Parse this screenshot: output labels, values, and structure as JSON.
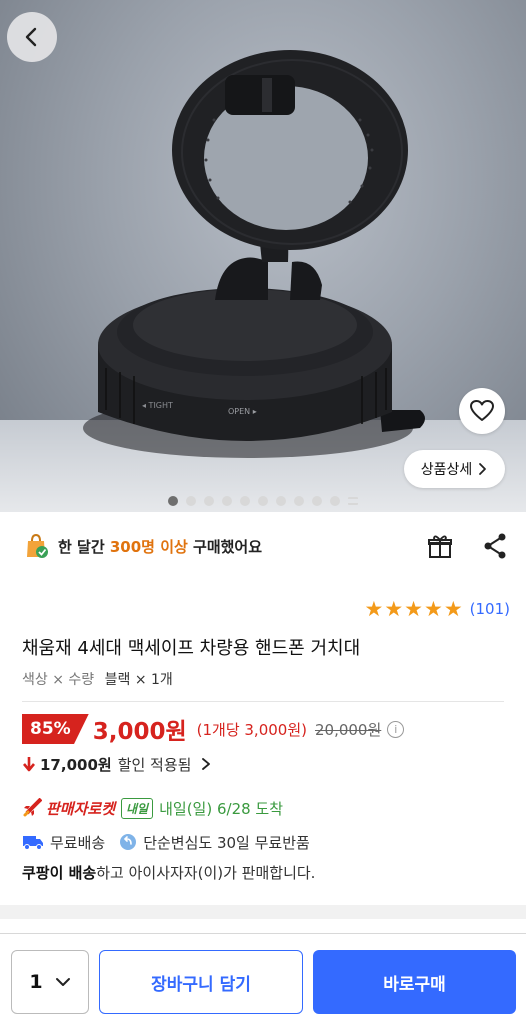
{
  "hero": {
    "detail_label": "상품상세",
    "image_count": 10,
    "current_image": 1,
    "dial_left_text": "◂ TIGHT",
    "dial_right_text": "OPEN ▸"
  },
  "sold": {
    "prefix": "한 달간",
    "highlight": "300명 이상",
    "suffix": "구매했어요"
  },
  "rating": {
    "stars": 5,
    "review_count": "(101)"
  },
  "product": {
    "title": "채움재 4세대 맥세이프 차량용 핸드폰 거치대",
    "option_label": "색상 × 수량",
    "option_value": "블랙 × 1개"
  },
  "price": {
    "discount": "85%",
    "sale_price": "3,000원",
    "unit_price": "(1개당 3,000원)",
    "original_price": "20,000원",
    "info_icon": "ⓘ",
    "saving_amount": "17,000원",
    "saving_text": "할인 적용됨"
  },
  "delivery": {
    "rocket_label": "판매자로켓",
    "tomorrow_badge": "내일",
    "arrival": "내일(일) 6/28 도착",
    "free_shipping": "무료배송",
    "free_return": "단순변심도 30일 무료반품",
    "seller_bold": "쿠팡이 배송",
    "seller_rest": "하고 아이사자자(이)가 판매합니다."
  },
  "bottom": {
    "quantity": "1",
    "cart_label": "장바구니 담기",
    "buy_label": "바로구매"
  },
  "colors": {
    "accent": "#346aff",
    "sale_red": "#d6231e",
    "star": "#f39a1a",
    "rocket_green": "#3a9a3f",
    "sold_orange": "#e0730e"
  }
}
